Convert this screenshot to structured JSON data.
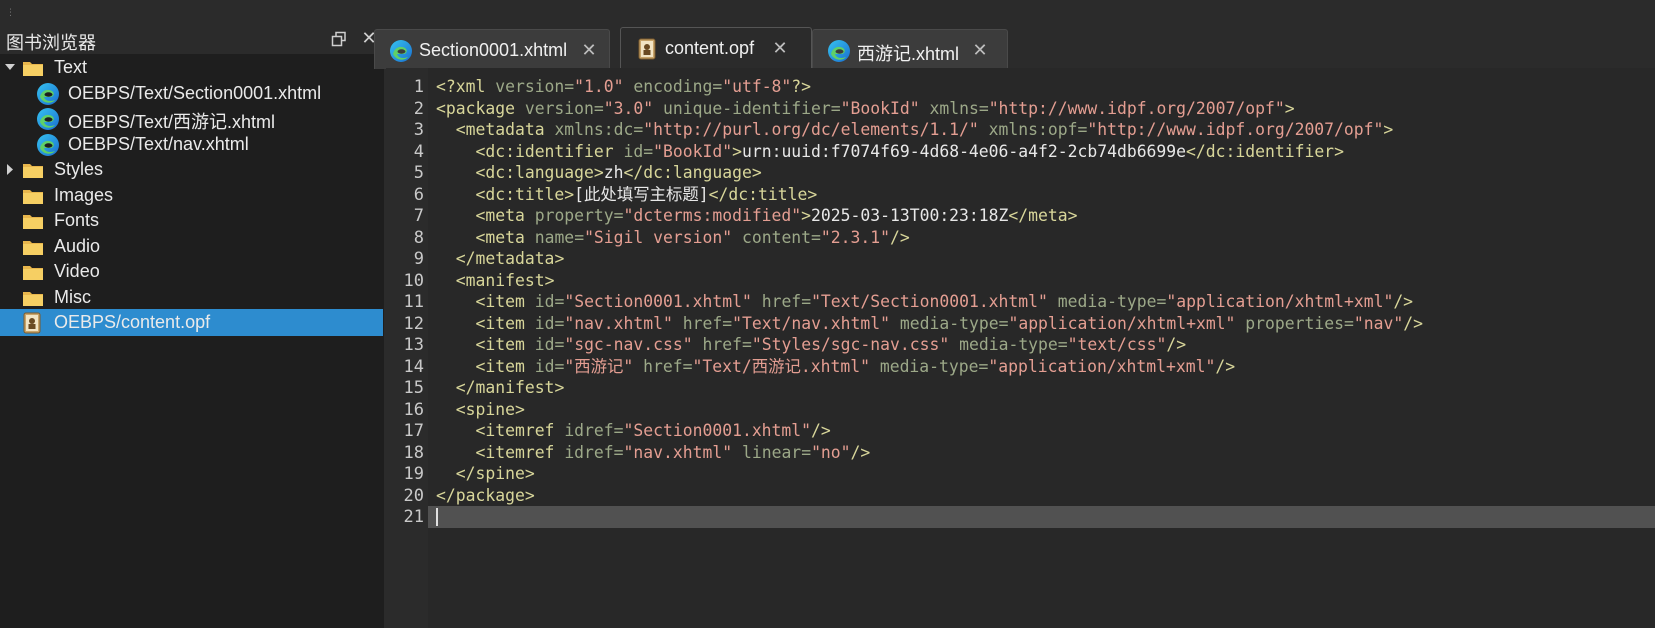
{
  "panel": {
    "title": "图书浏览器",
    "items": [
      {
        "kind": "folder",
        "label": "Text",
        "expanded": true
      },
      {
        "kind": "file",
        "label": "OEBPS/Text/Section0001.xhtml"
      },
      {
        "kind": "file",
        "label": "OEBPS/Text/西游记.xhtml"
      },
      {
        "kind": "file",
        "label": "OEBPS/Text/nav.xhtml"
      },
      {
        "kind": "folder",
        "label": "Styles",
        "expanded": false
      },
      {
        "kind": "folder",
        "label": "Images"
      },
      {
        "kind": "folder",
        "label": "Fonts"
      },
      {
        "kind": "folder",
        "label": "Audio"
      },
      {
        "kind": "folder",
        "label": "Video"
      },
      {
        "kind": "folder",
        "label": "Misc"
      },
      {
        "kind": "opf",
        "label": "OEBPS/content.opf",
        "selected": true
      }
    ]
  },
  "tabs": [
    {
      "label": "Section0001.xhtml",
      "icon": "edge-icon",
      "active": false
    },
    {
      "label": "content.opf",
      "icon": "opf-icon",
      "active": true
    },
    {
      "label": "西游记.xhtml",
      "icon": "edge-icon",
      "active": false
    }
  ],
  "tab_close_glyph": "✕",
  "editor": {
    "line_numbers": [
      "1",
      "2",
      "3",
      "4",
      "5",
      "6",
      "7",
      "8",
      "9",
      "10",
      "11",
      "12",
      "13",
      "14",
      "15",
      "16",
      "17",
      "18",
      "19",
      "20",
      "21"
    ],
    "lines": [
      "<?xml version=\"1.0\" encoding=\"utf-8\"?>",
      "<package version=\"3.0\" unique-identifier=\"BookId\" xmlns=\"http://www.idpf.org/2007/opf\">",
      "  <metadata xmlns:dc=\"http://purl.org/dc/elements/1.1/\" xmlns:opf=\"http://www.idpf.org/2007/opf\">",
      "    <dc:identifier id=\"BookId\">urn:uuid:f7074f69-4d68-4e06-a4f2-2cb74db6699e</dc:identifier>",
      "    <dc:language>zh</dc:language>",
      "    <dc:title>[此处填写主标题]</dc:title>",
      "    <meta property=\"dcterms:modified\">2025-03-13T00:23:18Z</meta>",
      "    <meta name=\"Sigil version\" content=\"2.3.1\"/>",
      "  </metadata>",
      "  <manifest>",
      "    <item id=\"Section0001.xhtml\" href=\"Text/Section0001.xhtml\" media-type=\"application/xhtml+xml\"/>",
      "    <item id=\"nav.xhtml\" href=\"Text/nav.xhtml\" media-type=\"application/xhtml+xml\" properties=\"nav\"/>",
      "    <item id=\"sgc-nav.css\" href=\"Styles/sgc-nav.css\" media-type=\"text/css\"/>",
      "    <item id=\"西游记\" href=\"Text/西游记.xhtml\" media-type=\"application/xhtml+xml\"/>",
      "  </manifest>",
      "  <spine>",
      "    <itemref idref=\"Section0001.xhtml\"/>",
      "    <itemref idref=\"nav.xhtml\" linear=\"no\"/>",
      "  </spine>",
      "</package>",
      ""
    ],
    "current_line": 21
  },
  "colors": {
    "tag": "#d8d69a",
    "attr": "#9ca888",
    "value": "#e49e92",
    "selection": "#2d8ccf"
  }
}
